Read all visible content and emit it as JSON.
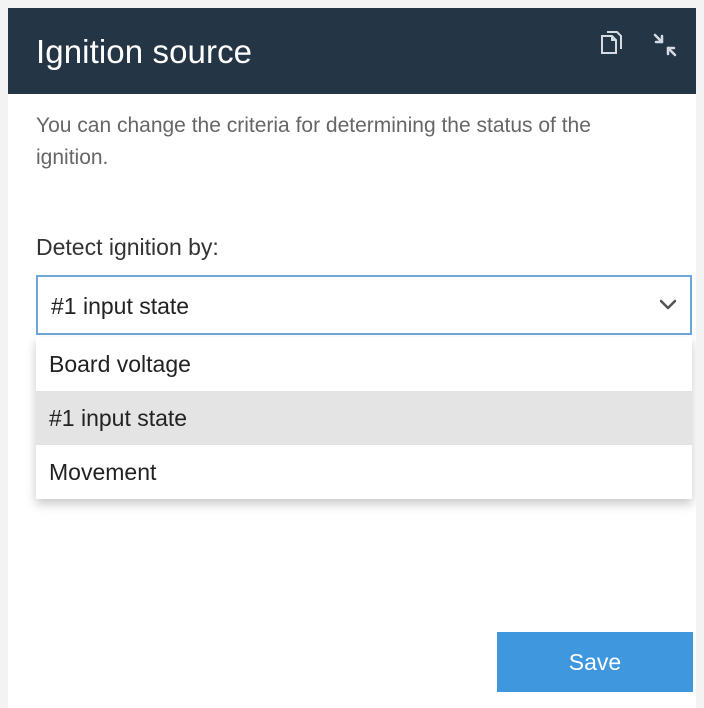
{
  "panel": {
    "title": "Ignition source",
    "header_icons": [
      "copy-icon",
      "collapse-icon"
    ],
    "description": "You can change the criteria for determining the status of the ignition.",
    "field_label": "Detect ignition by:",
    "select": {
      "selected_value": "#1 input state",
      "options": [
        "Board voltage",
        "#1 input state",
        "Movement"
      ],
      "highlighted_option": "#1 input state"
    },
    "save_label": "Save"
  },
  "colors": {
    "header_background": "#243546",
    "header_text": "#ffffff",
    "select_border": "#6ea7d8",
    "highlighted_option": "#e4e4e4",
    "save_button": "#3f97de",
    "description_text": "#666666"
  }
}
